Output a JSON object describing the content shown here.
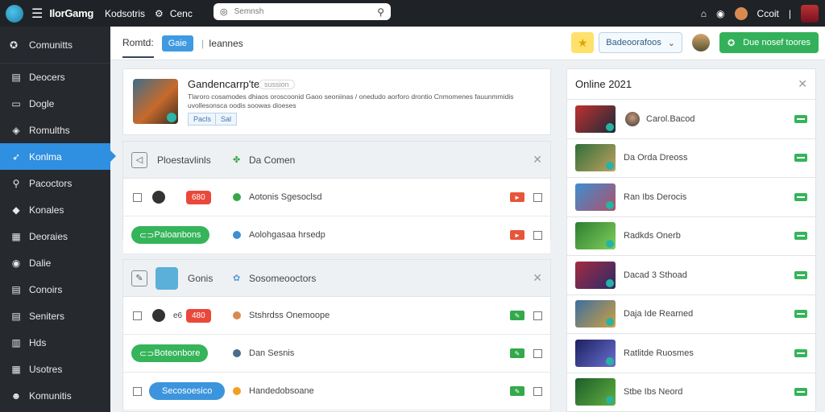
{
  "topbar": {
    "brand": "IlorGamg",
    "link1": "Kodsotris",
    "link2": "Cenc",
    "search_placeholder": "Semnsh",
    "user_label": "Ccoit"
  },
  "sidebar": {
    "top_label": "Comunitts",
    "items": [
      {
        "icon": "users-icon",
        "glyph": "▤",
        "label": "Deocers"
      },
      {
        "icon": "monitor-icon",
        "glyph": "▭",
        "label": "Dogle"
      },
      {
        "icon": "tag-icon",
        "glyph": "◈",
        "label": "Romulths"
      },
      {
        "icon": "rocket-icon",
        "glyph": "➶",
        "label": "Konlma",
        "active": true
      },
      {
        "icon": "search-icon",
        "glyph": "⚲",
        "label": "Pacoctors"
      },
      {
        "icon": "diamond-icon",
        "glyph": "◆",
        "label": "Konales"
      },
      {
        "icon": "grid-icon",
        "glyph": "▦",
        "label": "Deoraies"
      },
      {
        "icon": "globe-icon",
        "glyph": "◉",
        "label": "Dalie"
      },
      {
        "icon": "list-icon",
        "glyph": "▤",
        "label": "Conoirs"
      },
      {
        "icon": "table-icon",
        "glyph": "▤",
        "label": "Seniters"
      },
      {
        "icon": "apps-icon",
        "glyph": "▥",
        "label": "Hds"
      },
      {
        "icon": "calendar-icon",
        "glyph": "▦",
        "label": "Usotres"
      },
      {
        "icon": "people-icon",
        "glyph": "☻",
        "label": "Komunitis"
      }
    ]
  },
  "header": {
    "tab": "Romtd:",
    "pill": "Gaie",
    "link": "Ieannes",
    "dropdown": "Badeoorafoos",
    "green_button": "Due nosef toores"
  },
  "feature": {
    "title": "Gandencarrp'te",
    "tag": "sussion",
    "description": "Tlaroro cosamodes dhiaos oroscoonid Gaoo seoniinas / onedudo aorforo drontio Cnmomenes fauunmmidis uvollesonsca oodis soowas dioeses",
    "btn1": "Pacls",
    "btn2": "Sal"
  },
  "groups": [
    {
      "header_icon_type": "check",
      "title": "Ploestavlinls",
      "sub": "Da Comen",
      "rows": [
        {
          "kind": "bomb",
          "badge": "680",
          "text": "Aotonis Sgesoclsd",
          "dot": "#37a648",
          "action": "red"
        },
        {
          "kind": "pill-green",
          "pill": "Paloanbons",
          "text": "Aolohgasaa hrsedp",
          "dot": "#3d8fd0",
          "action": "red"
        }
      ]
    },
    {
      "header_icon_type": "edit",
      "title": "Gonis",
      "sub": "Sosomeooctors",
      "rows": [
        {
          "kind": "bomb",
          "small": "e6",
          "badge": "480",
          "text": "Stshrdss Onemoope",
          "dot": "#d98b4f",
          "action": "green"
        },
        {
          "kind": "pill-green",
          "pill": "Boteonbore",
          "text": "Dan Sesnis",
          "dot": "#4a6d8e",
          "action": "green"
        },
        {
          "kind": "pill-blue",
          "pill": "Secosoesico",
          "text": "Handedobsoane",
          "dot": "#f0a020",
          "action": "green"
        }
      ]
    }
  ],
  "online": {
    "title": "Online 2021",
    "rows": [
      {
        "name": "Carol.Bacod",
        "avatar": true,
        "colors": [
          "#c03030",
          "#1d2b38"
        ]
      },
      {
        "name": "Da Orda Dreoss",
        "avatar": false,
        "colors": [
          "#2f6f3a",
          "#c0a060"
        ]
      },
      {
        "name": "Ran Ibs Derocis",
        "avatar": false,
        "colors": [
          "#3c8fd0",
          "#b0506a"
        ]
      },
      {
        "name": "Radkds Onerb",
        "avatar": false,
        "colors": [
          "#2e7d32",
          "#7fd05a"
        ]
      },
      {
        "name": "Dacad 3 Sthoad",
        "avatar": false,
        "colors": [
          "#a32b3f",
          "#2b2b6a"
        ]
      },
      {
        "name": "Daja Ide Rearned",
        "avatar": false,
        "colors": [
          "#3c6fa0",
          "#d0a040"
        ]
      },
      {
        "name": "Ratlitde Ruosmes",
        "avatar": false,
        "colors": [
          "#1c2060",
          "#6a70d0"
        ]
      },
      {
        "name": "Stbe Ibs Neord",
        "avatar": false,
        "colors": [
          "#1d5c2a",
          "#60b040"
        ]
      }
    ]
  }
}
